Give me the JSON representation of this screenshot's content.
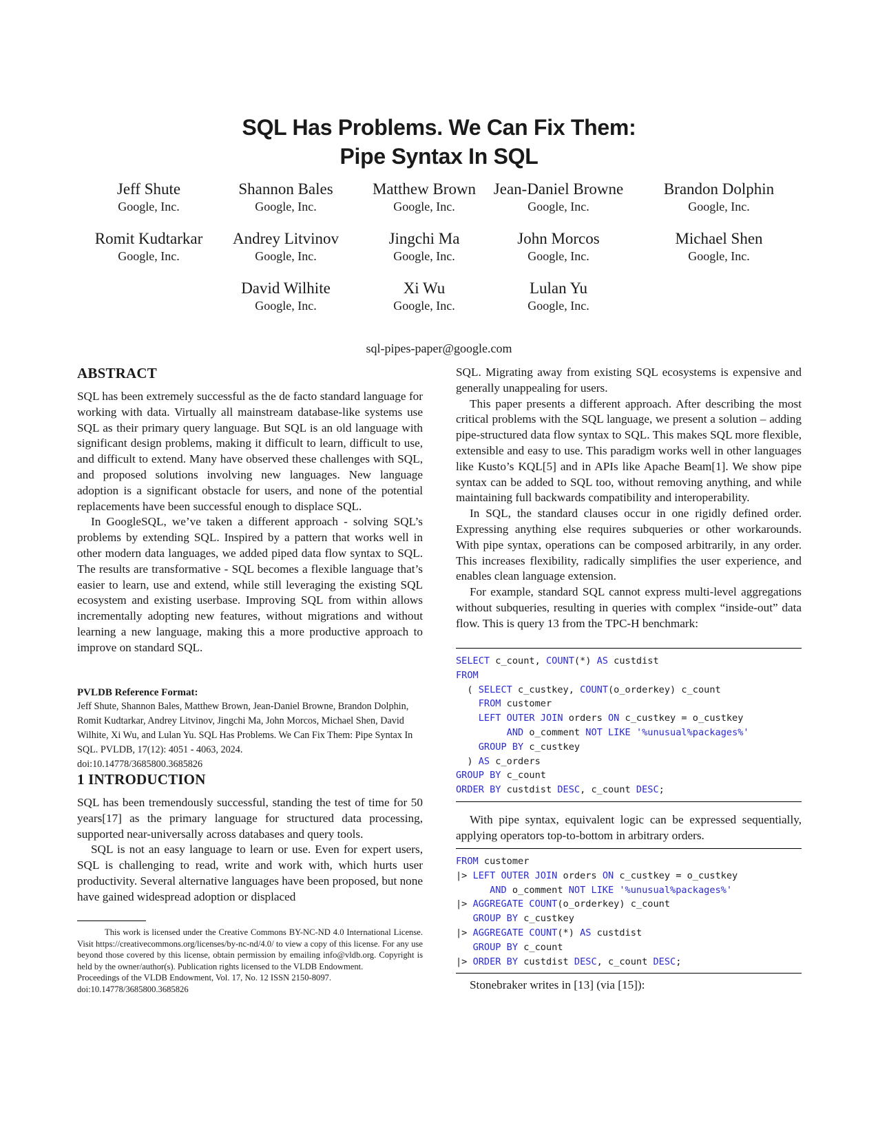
{
  "paper": {
    "title_line1": "SQL Has Problems. We Can Fix Them:",
    "title_line2": "Pipe Syntax In SQL",
    "authors": [
      {
        "name": "Jeff Shute",
        "affiliation": "Google, Inc."
      },
      {
        "name": "Shannon Bales",
        "affiliation": "Google, Inc."
      },
      {
        "name": "Matthew Brown",
        "affiliation": "Google, Inc."
      },
      {
        "name": "Jean-Daniel Browne",
        "affiliation": "Google, Inc."
      },
      {
        "name": "Brandon Dolphin",
        "affiliation": "Google, Inc."
      },
      {
        "name": "Romit Kudtarkar",
        "affiliation": "Google, Inc."
      },
      {
        "name": "Andrey Litvinov",
        "affiliation": "Google, Inc."
      },
      {
        "name": "Jingchi Ma",
        "affiliation": "Google, Inc."
      },
      {
        "name": "John Morcos",
        "affiliation": "Google, Inc."
      },
      {
        "name": "Michael Shen",
        "affiliation": "Google, Inc."
      },
      {
        "name": "David Wilhite",
        "affiliation": "Google, Inc."
      },
      {
        "name": "Xi Wu",
        "affiliation": "Google, Inc."
      },
      {
        "name": "Lulan Yu",
        "affiliation": "Google, Inc."
      }
    ],
    "email": "sql-pipes-paper@google.com"
  },
  "abstract": {
    "heading": "ABSTRACT",
    "paragraphs": [
      "SQL has been extremely successful as the de facto standard language for working with data. Virtually all mainstream database-like systems use SQL as their primary query language. But SQL is an old language with significant design problems, making it difficult to learn, difficult to use, and difficult to extend. Many have observed these challenges with SQL, and proposed solutions involving new languages. New language adoption is a significant obstacle for users, and none of the potential replacements have been successful enough to displace SQL.",
      "In GoogleSQL, we’ve taken a different approach - solving SQL’s problems by extending SQL. Inspired by a pattern that works well in other modern data languages, we added piped data flow syntax to SQL. The results are transformative - SQL becomes a flexible language that’s easier to learn, use and extend, while still leveraging the existing SQL ecosystem and existing userbase. Improving SQL from within allows incrementally adopting new features, without migrations and without learning a new language, making this a more productive approach to improve on standard SQL."
    ]
  },
  "reference_format": {
    "heading": "PVLDB Reference Format:",
    "text": "Jeff Shute, Shannon Bales, Matthew Brown, Jean-Daniel Browne, Brandon Dolphin, Romit Kudtarkar, Andrey Litvinov, Jingchi Ma, John Morcos, Michael Shen, David Wilhite, Xi Wu, and Lulan Yu. SQL Has Problems. We Can Fix Them: Pipe Syntax In SQL. PVLDB, 17(12): 4051 - 4063, 2024.",
    "doi": "doi:10.14778/3685800.3685826"
  },
  "introduction": {
    "heading": "1   INTRODUCTION",
    "paragraphs": [
      "SQL has been tremendously successful, standing the test of time for 50 years[17] as the primary language for structured data processing, supported near-universally across databases and query tools.",
      "SQL is not an easy language to learn or use. Even for expert users, SQL is challenging to read, write and work with, which hurts user productivity. Several alternative languages have been proposed, but none have gained widespread adoption or displaced"
    ]
  },
  "footnote": {
    "license": "This work is licensed under the Creative Commons BY-NC-ND 4.0 International License. Visit https://creativecommons.org/licenses/by-nc-nd/4.0/ to view a copy of this license. For any use beyond those covered by this license, obtain permission by emailing info@vldb.org. Copyright is held by the owner/author(s). Publication rights licensed to the VLDB Endowment.",
    "proceedings": "Proceedings of the VLDB Endowment, Vol. 17, No. 12 ISSN 2150-8097.",
    "doi": "doi:10.14778/3685800.3685826"
  },
  "right_column": {
    "p1": "SQL. Migrating away from existing SQL ecosystems is expensive and generally unappealing for users.",
    "p2": "This paper presents a different approach. After describing the most critical problems with the SQL language, we present a solution – adding pipe-structured data flow syntax to SQL. This makes SQL more flexible, extensible and easy to use. This paradigm works well in other languages like Kusto’s KQL[5] and in APIs like Apache Beam[1]. We show pipe syntax can be added to SQL too, without removing anything, and while maintaining full backwards compatibility and interoperability.",
    "p3": "In SQL, the standard clauses occur in one rigidly defined order. Expressing anything else requires subqueries or other workarounds. With pipe syntax, operations can be composed arbitrarily, in any order. This increases flexibility, radically simplifies the user experience, and enables clean language extension.",
    "p4": "For example, standard SQL cannot express multi-level aggregations without subqueries, resulting in queries with complex “inside-out” data flow. This is query 13 from the TPC-H benchmark:",
    "p5": "With pipe syntax, equivalent logic can be expressed sequentially, applying operators top-to-bottom in arbitrary orders.",
    "p6": "Stonebraker writes in [13] (via [15]):"
  },
  "code_standard": [
    [
      [
        "kw",
        "SELECT"
      ],
      [
        "t",
        " c_count, "
      ],
      [
        "kw",
        "COUNT"
      ],
      [
        "t",
        "(*) "
      ],
      [
        "kw",
        "AS"
      ],
      [
        "t",
        " custdist"
      ]
    ],
    [
      [
        "kw",
        "FROM"
      ]
    ],
    [
      [
        "t",
        "  ( "
      ],
      [
        "kw",
        "SELECT"
      ],
      [
        "t",
        " c_custkey, "
      ],
      [
        "kw",
        "COUNT"
      ],
      [
        "t",
        "(o_orderkey) c_count"
      ]
    ],
    [
      [
        "t",
        "    "
      ],
      [
        "kw",
        "FROM"
      ],
      [
        "t",
        " customer"
      ]
    ],
    [
      [
        "t",
        "    "
      ],
      [
        "kw",
        "LEFT OUTER JOIN"
      ],
      [
        "t",
        " orders "
      ],
      [
        "kw",
        "ON"
      ],
      [
        "t",
        " c_custkey = o_custkey"
      ]
    ],
    [
      [
        "t",
        "         "
      ],
      [
        "kw",
        "AND"
      ],
      [
        "t",
        " o_comment "
      ],
      [
        "kw",
        "NOT LIKE"
      ],
      [
        "t",
        " "
      ],
      [
        "kw",
        "'%unusual%packages%'"
      ]
    ],
    [
      [
        "t",
        "    "
      ],
      [
        "kw",
        "GROUP BY"
      ],
      [
        "t",
        " c_custkey"
      ]
    ],
    [
      [
        "t",
        "  ) "
      ],
      [
        "kw",
        "AS"
      ],
      [
        "t",
        " c_orders"
      ]
    ],
    [
      [
        "kw",
        "GROUP BY"
      ],
      [
        "t",
        " c_count"
      ]
    ],
    [
      [
        "kw",
        "ORDER BY"
      ],
      [
        "t",
        " custdist "
      ],
      [
        "kw",
        "DESC"
      ],
      [
        "t",
        ", c_count "
      ],
      [
        "kw",
        "DESC"
      ],
      [
        "t",
        ";"
      ]
    ]
  ],
  "code_pipe": [
    [
      [
        "kw",
        "FROM"
      ],
      [
        "t",
        " customer"
      ]
    ],
    [
      [
        "t",
        "|> "
      ],
      [
        "kw",
        "LEFT OUTER JOIN"
      ],
      [
        "t",
        " orders "
      ],
      [
        "kw",
        "ON"
      ],
      [
        "t",
        " c_custkey = o_custkey"
      ]
    ],
    [
      [
        "t",
        "      "
      ],
      [
        "kw",
        "AND"
      ],
      [
        "t",
        " o_comment "
      ],
      [
        "kw",
        "NOT LIKE"
      ],
      [
        "t",
        " "
      ],
      [
        "kw",
        "'%unusual%packages%'"
      ]
    ],
    [
      [
        "t",
        "|> "
      ],
      [
        "kw",
        "AGGREGATE"
      ],
      [
        "t",
        " "
      ],
      [
        "kw",
        "COUNT"
      ],
      [
        "t",
        "(o_orderkey) c_count"
      ]
    ],
    [
      [
        "t",
        "   "
      ],
      [
        "kw",
        "GROUP BY"
      ],
      [
        "t",
        " c_custkey"
      ]
    ],
    [
      [
        "t",
        "|> "
      ],
      [
        "kw",
        "AGGREGATE"
      ],
      [
        "t",
        " "
      ],
      [
        "kw",
        "COUNT"
      ],
      [
        "t",
        "(*) "
      ],
      [
        "kw",
        "AS"
      ],
      [
        "t",
        " custdist"
      ]
    ],
    [
      [
        "t",
        "   "
      ],
      [
        "kw",
        "GROUP BY"
      ],
      [
        "t",
        " c_count"
      ]
    ],
    [
      [
        "t",
        "|> "
      ],
      [
        "kw",
        "ORDER BY"
      ],
      [
        "t",
        " custdist "
      ],
      [
        "kw",
        "DESC"
      ],
      [
        "t",
        ", c_count "
      ],
      [
        "kw",
        "DESC"
      ],
      [
        "t",
        ";"
      ]
    ]
  ],
  "colors": {
    "sql_keyword": "#2a2ad2",
    "text": "#1a1a1a"
  }
}
